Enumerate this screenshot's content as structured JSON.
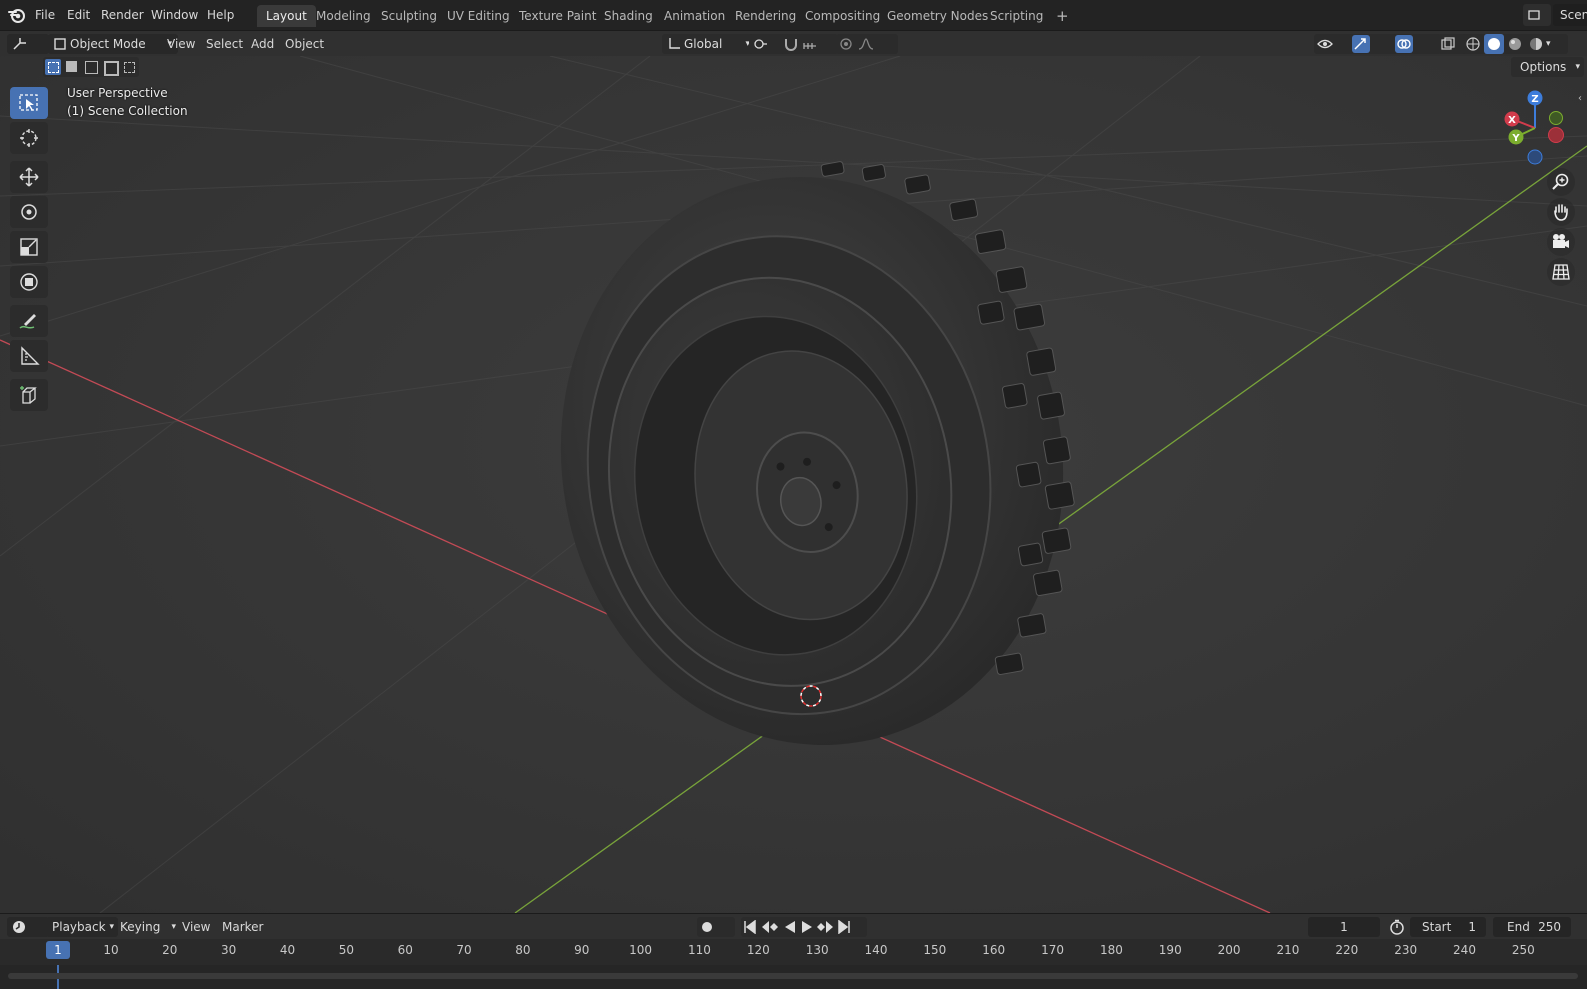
{
  "menu": [
    "File",
    "Edit",
    "Render",
    "Window",
    "Help"
  ],
  "workspaces": [
    "Layout",
    "Modeling",
    "Sculpting",
    "UV Editing",
    "Texture Paint",
    "Shading",
    "Animation",
    "Rendering",
    "Compositing",
    "Geometry Nodes",
    "Scripting",
    "+"
  ],
  "active_workspace": "Layout",
  "scene_label": "Scen",
  "header": {
    "mode": "Object Mode",
    "menu": [
      "View",
      "Select",
      "Add",
      "Object"
    ],
    "orientation": "Global",
    "options": "Options"
  },
  "viewport": {
    "perspective": "User Perspective",
    "collection": "(1) Scene Collection"
  },
  "gizmo": {
    "x": "X",
    "y": "Y",
    "z": "Z"
  },
  "timeline": {
    "menus": [
      "Playback",
      "Keying",
      "View",
      "Marker"
    ],
    "current_frame": "1",
    "start_label": "Start",
    "start": "1",
    "end_label": "End",
    "end": "250",
    "ruler_marks": [
      "1",
      "10",
      "20",
      "30",
      "40",
      "50",
      "60",
      "70",
      "80",
      "90",
      "100",
      "110",
      "120",
      "130",
      "140",
      "150",
      "160",
      "170",
      "180",
      "190",
      "200",
      "210",
      "220",
      "230",
      "240",
      "250"
    ]
  },
  "colors": {
    "accent": "#4772b3",
    "x_axis": "#d23c4c",
    "y_axis": "#7cad2e",
    "z_axis": "#3d7ddb"
  },
  "icons": [
    "blender-logo-icon",
    "select-box-icon",
    "cursor-icon",
    "move-icon",
    "rotate-icon",
    "scale-icon",
    "transform-icon",
    "annotate-icon",
    "measure-icon",
    "add-cube-icon",
    "zoom-icon",
    "hand-pan-icon",
    "camera-icon",
    "grid-ortho-icon"
  ]
}
